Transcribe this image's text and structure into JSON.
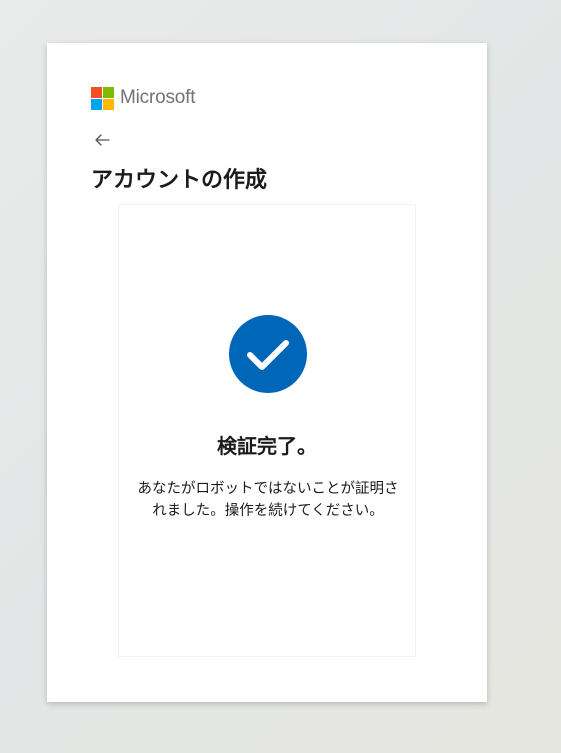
{
  "brand": {
    "name": "Microsoft",
    "logo_colors": [
      "#f25022",
      "#7fba00",
      "#00a4ef",
      "#ffb900"
    ]
  },
  "header": {
    "back_icon": "arrow-left-icon",
    "title": "アカウントの作成"
  },
  "verification": {
    "icon": "check-circle-icon",
    "icon_color": "#0067b8",
    "title": "検証完了。",
    "message": "あなたがロボットではないことが証明されました。操作を続けてください。"
  }
}
